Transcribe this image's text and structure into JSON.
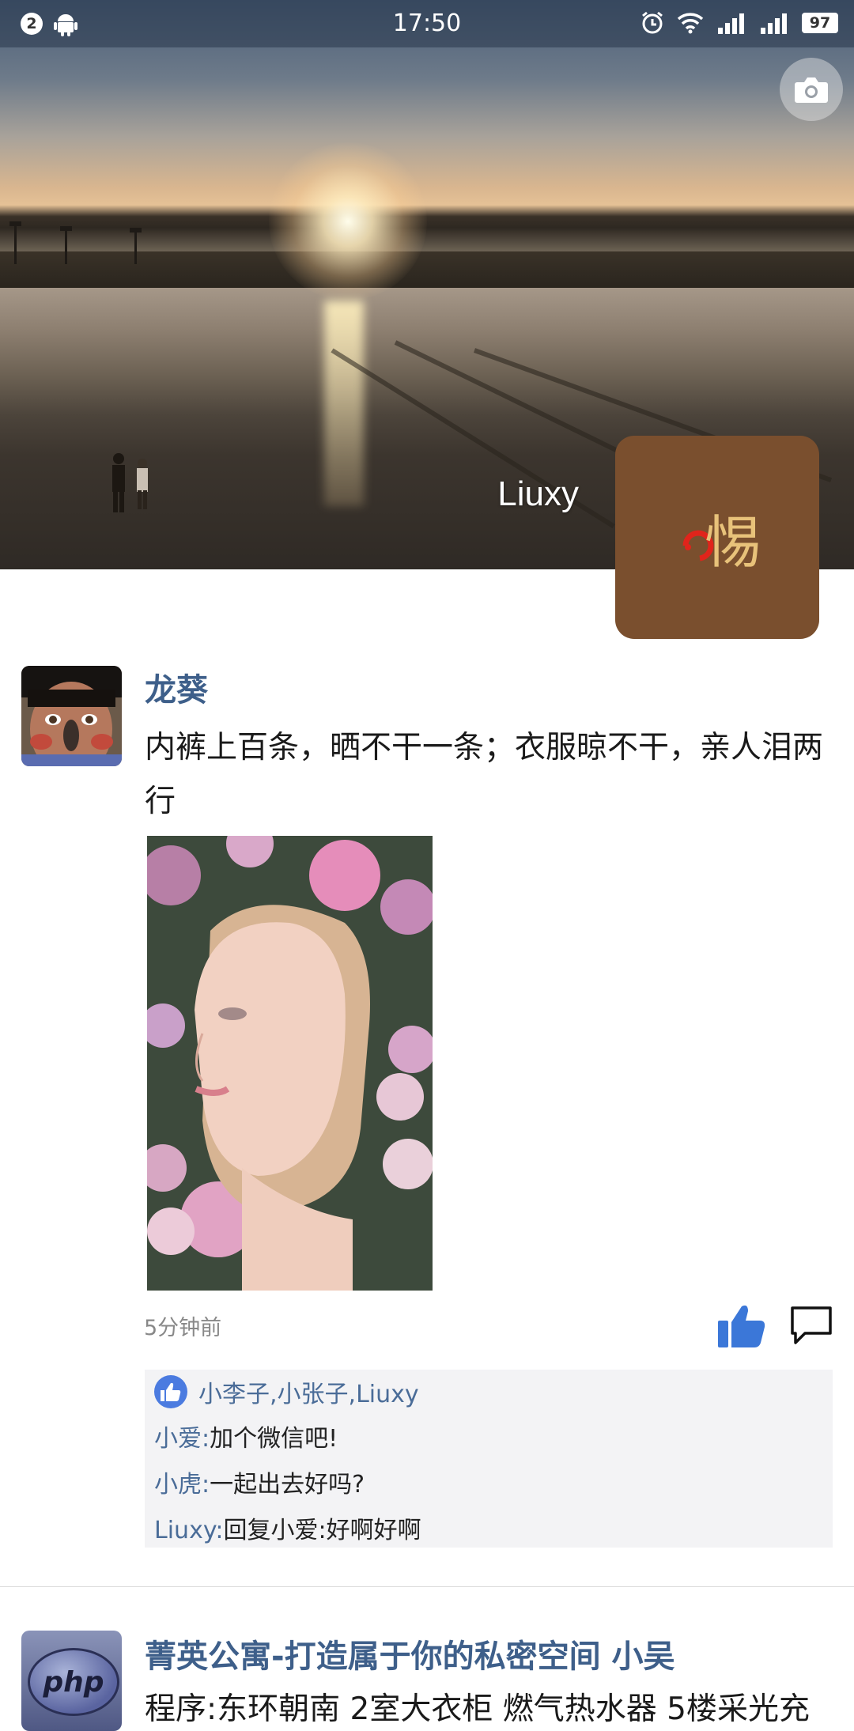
{
  "status_bar": {
    "notification_count": "2",
    "time": "17:50",
    "battery": "97"
  },
  "profile": {
    "name": "Liuxy",
    "avatar_logo_text": "惕",
    "avatar_bg": "#7a4f2e"
  },
  "posts": [
    {
      "user": "龙葵",
      "text": "内裤上百条，晒不干一条；衣服晾不干，亲人泪两行",
      "time": "5分钟前",
      "likes": "小李子,小张子,Liuxy",
      "comments": [
        {
          "author": "小爱:",
          "text": "加个微信吧!"
        },
        {
          "author": "小虎:",
          "text": "一起出去好吗?"
        },
        {
          "author": "Liuxy:",
          "text": "回复小爱:好啊好啊"
        }
      ]
    },
    {
      "user": "菁英公寓-打造属于你的私密空间 小吴",
      "text": "程序:东环朝南 2室大衣柜 燃气热水器 5楼采光充",
      "avatar_text": "php"
    }
  ],
  "colors": {
    "link_blue": "#3e5f8a",
    "like_blue": "#3b77d8",
    "reply_bg": "#f3f3f5"
  }
}
